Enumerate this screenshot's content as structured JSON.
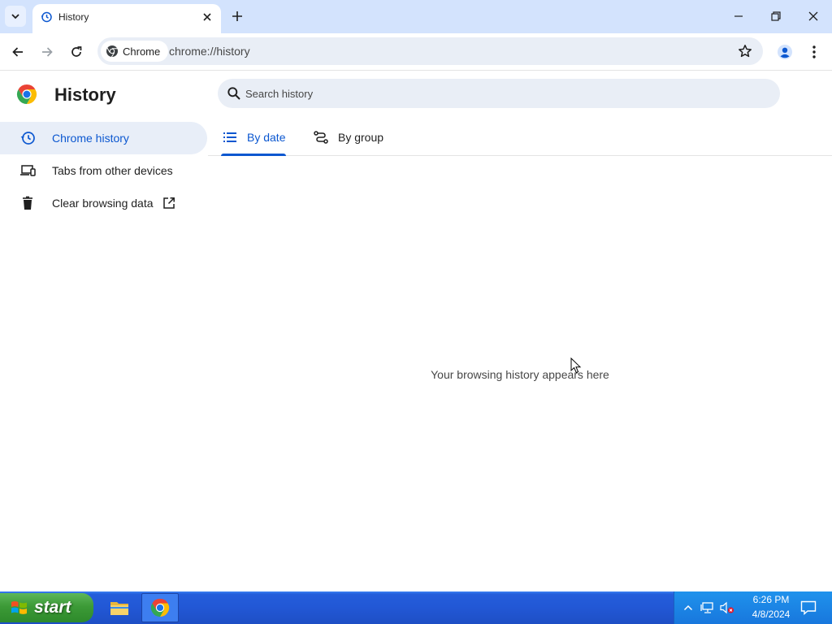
{
  "window": {
    "tab_title": "History",
    "icons": {
      "tab_search": "chevron-down-icon",
      "tab_favicon": "history-icon",
      "tab_close": "close-icon",
      "new_tab": "plus-icon",
      "minimize": "minimize-icon",
      "restore": "restore-icon",
      "close": "close-icon"
    }
  },
  "toolbar": {
    "site_chip_label": "Chrome",
    "url": "chrome://history",
    "icons": {
      "back": "back-arrow-icon",
      "forward": "forward-arrow-icon",
      "reload": "reload-icon",
      "bookmark": "star-icon",
      "profile": "person-icon",
      "menu": "kebab-menu-icon"
    }
  },
  "page": {
    "title": "History",
    "search": {
      "placeholder": "Search history",
      "value": ""
    },
    "sidebar": {
      "items": [
        {
          "label": "Chrome history",
          "icon": "history-icon",
          "selected": true
        },
        {
          "label": "Tabs from other devices",
          "icon": "devices-icon",
          "selected": false
        },
        {
          "label": "Clear browsing data",
          "icon": "trash-icon",
          "selected": false,
          "external": true
        }
      ]
    },
    "view_tabs": [
      {
        "label": "By date",
        "icon": "list-icon",
        "selected": true
      },
      {
        "label": "By group",
        "icon": "journeys-icon",
        "selected": false
      }
    ],
    "empty_message": "Your browsing history appears here"
  },
  "taskbar": {
    "start_label": "start",
    "apps": [
      {
        "name": "File Explorer",
        "icon": "folder-icon",
        "active": false
      },
      {
        "name": "Google Chrome",
        "icon": "chrome-icon",
        "active": true
      }
    ],
    "clock": {
      "time": "6:26 PM",
      "date": "4/8/2024"
    }
  },
  "colors": {
    "tabstrip_bg": "#d3e3fd",
    "accent_blue": "#0b57d0",
    "selected_item_bg": "#e8eef8",
    "omnibox_bg": "#e9eef6",
    "taskbar_blue": "#245edb",
    "start_green": "#3c9a37"
  }
}
